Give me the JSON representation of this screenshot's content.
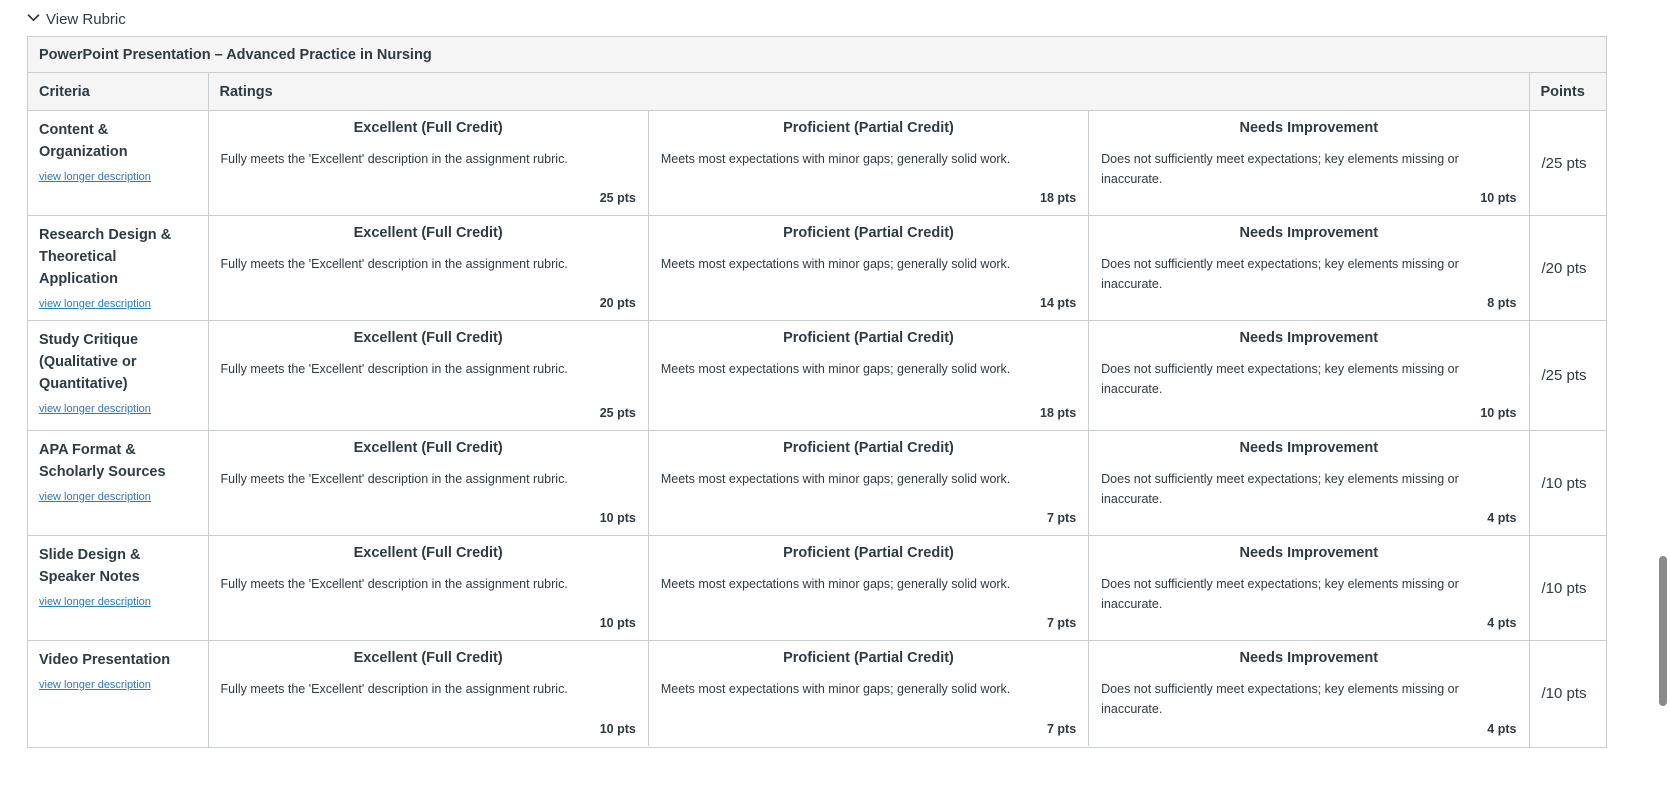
{
  "toggle": {
    "label": "View Rubric",
    "icon": "chevron-down-icon"
  },
  "rubric": {
    "title": "PowerPoint Presentation – Advanced Practice in Nursing",
    "headers": {
      "criteria": "Criteria",
      "ratings": "Ratings",
      "points": "Points"
    },
    "criteria": [
      {
        "name": "Content & Organization",
        "link": "view longer description",
        "points": "/25 pts",
        "ratings": [
          {
            "title": "Excellent (Full Credit)",
            "description": "Fully meets the 'Excellent' description in the assignment rubric.",
            "points": "25 pts"
          },
          {
            "title": "Proficient (Partial Credit)",
            "description": "Meets most expectations with minor gaps; generally solid work.",
            "points": "18 pts"
          },
          {
            "title": "Needs Improvement",
            "description": "Does not sufficiently meet expectations; key elements missing or inaccurate.",
            "points": "10 pts"
          }
        ]
      },
      {
        "name": "Research Design & Theoretical Application",
        "link": "view longer description",
        "points": "/20 pts",
        "ratings": [
          {
            "title": "Excellent (Full Credit)",
            "description": "Fully meets the 'Excellent' description in the assignment rubric.",
            "points": "20 pts"
          },
          {
            "title": "Proficient (Partial Credit)",
            "description": "Meets most expectations with minor gaps; generally solid work.",
            "points": "14 pts"
          },
          {
            "title": "Needs Improvement",
            "description": "Does not sufficiently meet expectations; key elements missing or inaccurate.",
            "points": "8 pts"
          }
        ]
      },
      {
        "name": "Study Critique (Qualitative or Quantitative)",
        "link": "view longer description",
        "points": "/25 pts",
        "ratings": [
          {
            "title": "Excellent (Full Credit)",
            "description": "Fully meets the 'Excellent' description in the assignment rubric.",
            "points": "25 pts"
          },
          {
            "title": "Proficient (Partial Credit)",
            "description": "Meets most expectations with minor gaps; generally solid work.",
            "points": "18 pts"
          },
          {
            "title": "Needs Improvement",
            "description": "Does not sufficiently meet expectations; key elements missing or inaccurate.",
            "points": "10 pts"
          }
        ]
      },
      {
        "name": "APA Format & Scholarly Sources",
        "link": "view longer description",
        "points": "/10 pts",
        "ratings": [
          {
            "title": "Excellent (Full Credit)",
            "description": "Fully meets the 'Excellent' description in the assignment rubric.",
            "points": "10 pts"
          },
          {
            "title": "Proficient (Partial Credit)",
            "description": "Meets most expectations with minor gaps; generally solid work.",
            "points": "7 pts"
          },
          {
            "title": "Needs Improvement",
            "description": "Does not sufficiently meet expectations; key elements missing or inaccurate.",
            "points": "4 pts"
          }
        ]
      },
      {
        "name": "Slide Design & Speaker Notes",
        "link": "view longer description",
        "points": "/10 pts",
        "ratings": [
          {
            "title": "Excellent (Full Credit)",
            "description": "Fully meets the 'Excellent' description in the assignment rubric.",
            "points": "10 pts"
          },
          {
            "title": "Proficient (Partial Credit)",
            "description": "Meets most expectations with minor gaps; generally solid work.",
            "points": "7 pts"
          },
          {
            "title": "Needs Improvement",
            "description": "Does not sufficiently meet expectations; key elements missing or inaccurate.",
            "points": "4 pts"
          }
        ]
      },
      {
        "name": "Video Presentation",
        "link": "view longer description",
        "points": "/10 pts",
        "ratings": [
          {
            "title": "Excellent (Full Credit)",
            "description": "Fully meets the 'Excellent' description in the assignment rubric.",
            "points": "10 pts"
          },
          {
            "title": "Proficient (Partial Credit)",
            "description": "Meets most expectations with minor gaps; generally solid work.",
            "points": "7 pts"
          },
          {
            "title": "Needs Improvement",
            "description": "Does not sufficiently meet expectations; key elements missing or inaccurate.",
            "points": "4 pts"
          }
        ]
      }
    ]
  }
}
